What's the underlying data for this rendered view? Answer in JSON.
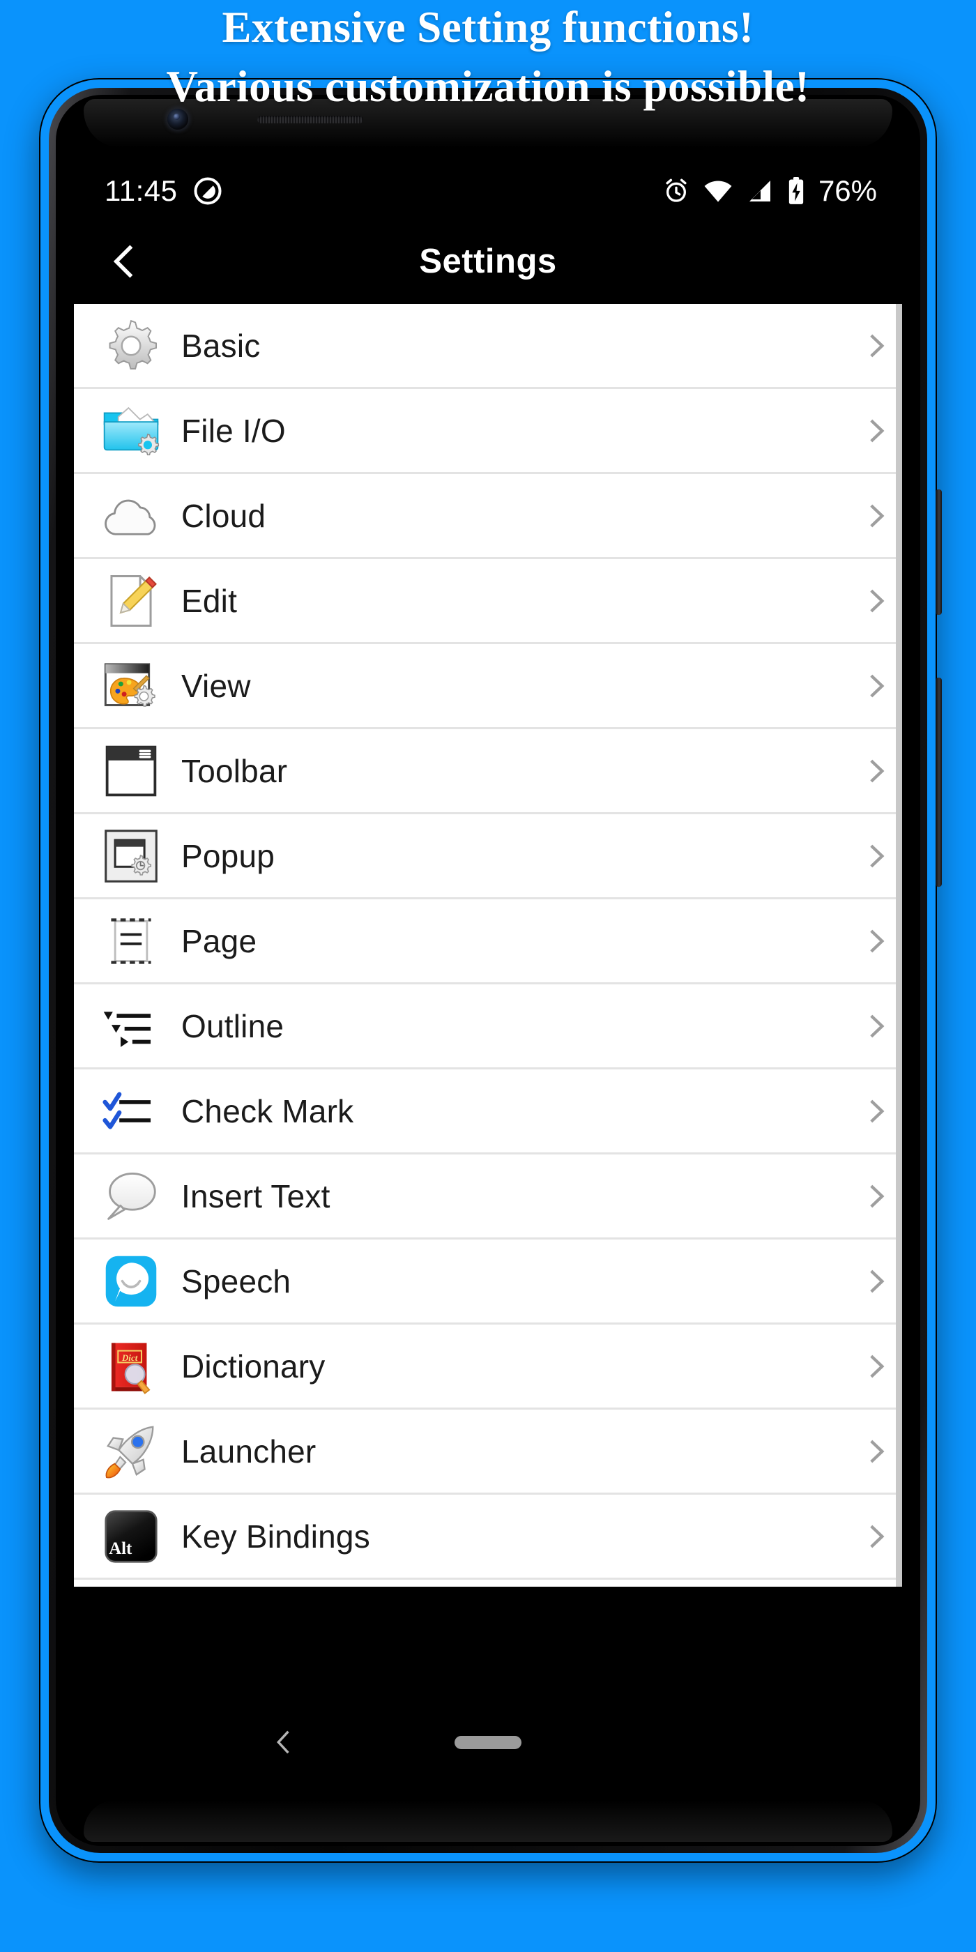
{
  "promo": {
    "line1": "Extensive Setting functions!",
    "line2": "Various customization is possible!",
    "text_color": "#ffffff",
    "background_color": "#0a93fc"
  },
  "status_bar": {
    "time": "11:45",
    "dnd_icon": "do-not-disturb-icon",
    "alarm_icon": "alarm-clock-icon",
    "wifi_icon": "wifi-icon",
    "signal_icon": "cellular-signal-icon",
    "battery_icon": "battery-charging-icon",
    "battery_text": "76%"
  },
  "app_bar": {
    "back_icon": "back-chevron-icon",
    "title": "Settings"
  },
  "settings_list": {
    "chevron_icon": "chevron-right-icon",
    "items": [
      {
        "label": "Basic",
        "icon": "gear-icon"
      },
      {
        "label": "File I/O",
        "icon": "folder-gear-icon"
      },
      {
        "label": "Cloud",
        "icon": "cloud-icon"
      },
      {
        "label": "Edit",
        "icon": "page-pencil-icon"
      },
      {
        "label": "View",
        "icon": "window-palette-gear-icon"
      },
      {
        "label": "Toolbar",
        "icon": "window-menu-icon"
      },
      {
        "label": "Popup",
        "icon": "popup-window-gear-icon"
      },
      {
        "label": "Page",
        "icon": "page-lines-icon"
      },
      {
        "label": "Outline",
        "icon": "outline-tree-icon"
      },
      {
        "label": "Check Mark",
        "icon": "checkmark-list-icon"
      },
      {
        "label": "Insert Text",
        "icon": "speech-bubble-outline-icon"
      },
      {
        "label": "Speech",
        "icon": "speech-app-icon"
      },
      {
        "label": "Dictionary",
        "icon": "dictionary-book-icon"
      },
      {
        "label": "Launcher",
        "icon": "rocket-icon"
      },
      {
        "label": "Key Bindings",
        "icon": "alt-key-icon"
      },
      {
        "label": "",
        "icon": "red-star-icon"
      }
    ]
  },
  "nav_bar": {
    "back_icon": "nav-back-chevron-icon",
    "home_pill": "home-gesture-pill"
  },
  "device": {
    "camera": "front-camera-lens",
    "earpiece": "earpiece-speaker-grille",
    "power_button": "power-button",
    "volume_button": "volume-rocker-button"
  }
}
